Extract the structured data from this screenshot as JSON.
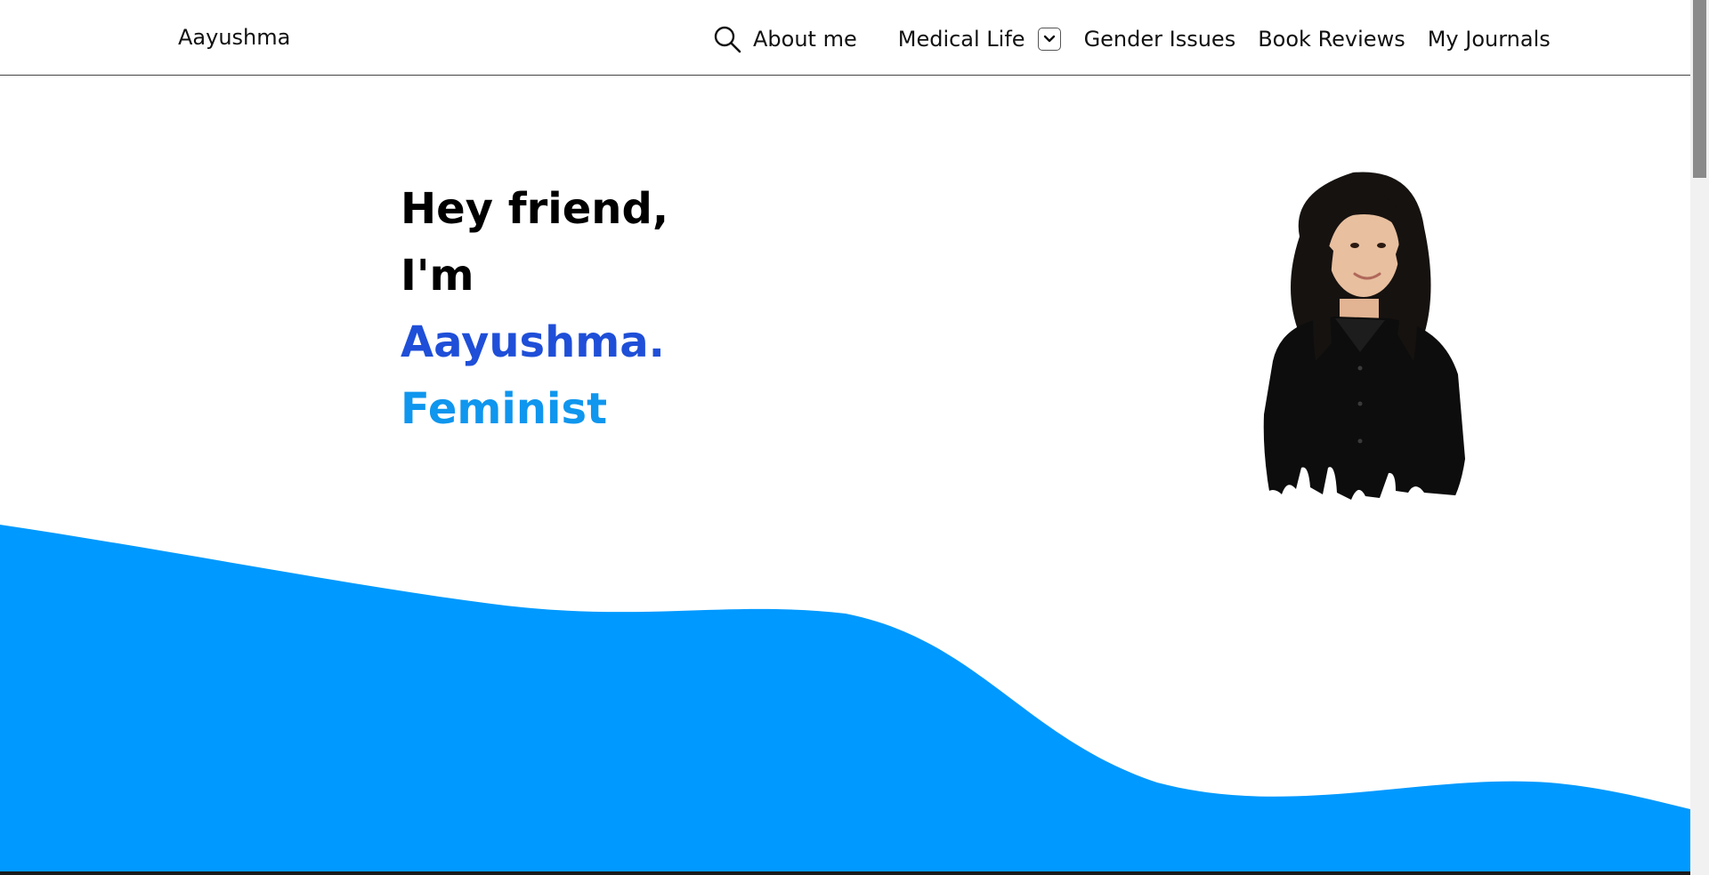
{
  "header": {
    "brand": "Aayushma",
    "nav": {
      "search_icon": "search-icon",
      "about": "About me",
      "medical": "Medical Life",
      "dropdown_icon": "chevron-down-icon",
      "gender": "Gender Issues",
      "books": "Book Reviews",
      "journals": "My Journals"
    }
  },
  "hero": {
    "greeting_line1": "Hey friend,",
    "greeting_line2": "I'm",
    "name": "Aayushma.",
    "role": "Feminist"
  },
  "colors": {
    "accent_blue": "#0099ff",
    "name_blue": "#1f4fd8",
    "role_blue": "#0f96ee",
    "text": "#111111"
  }
}
